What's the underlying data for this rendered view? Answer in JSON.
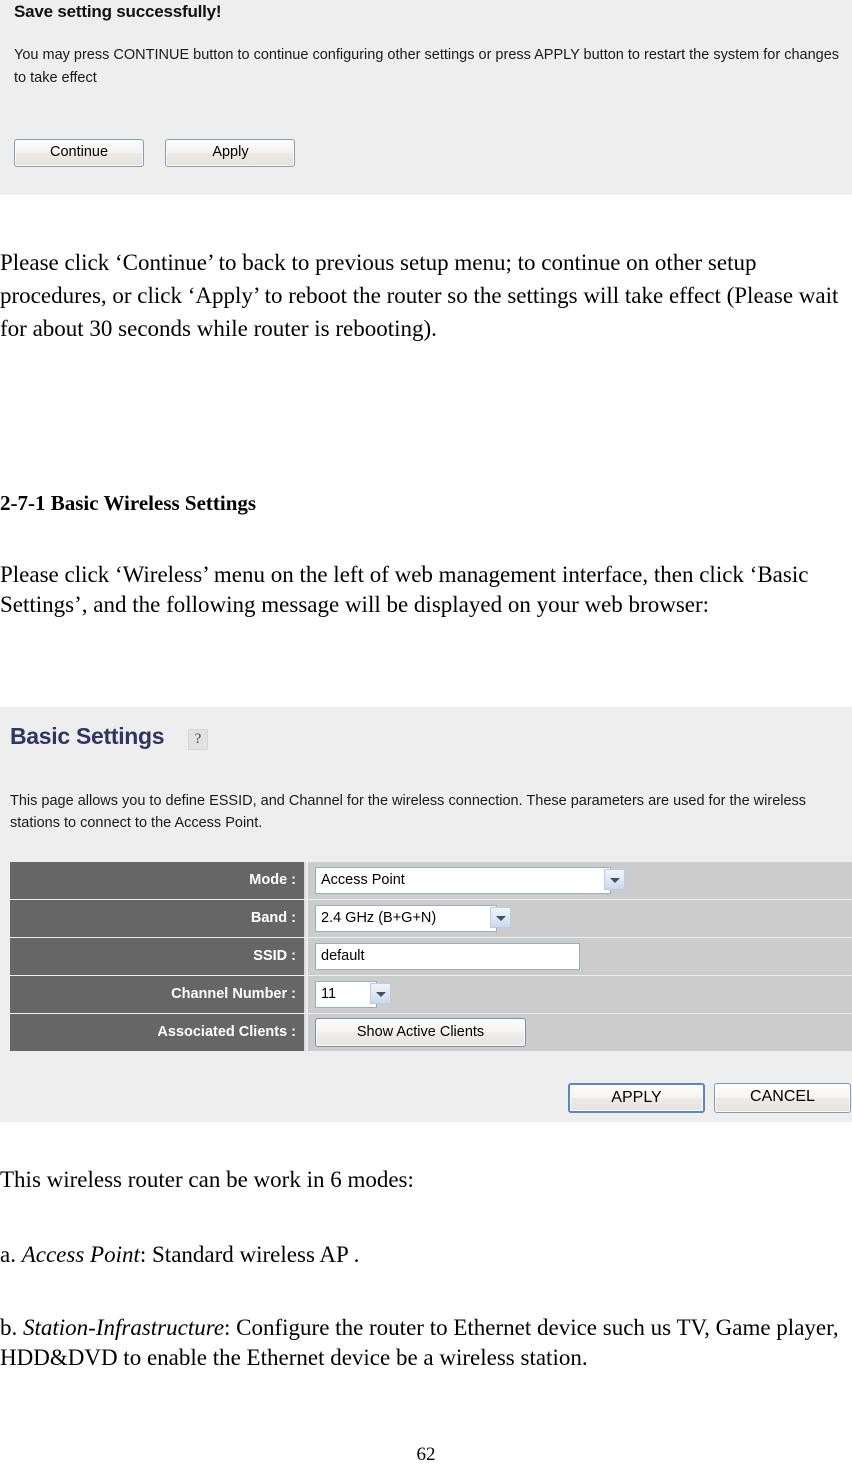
{
  "save_panel": {
    "title": "Save setting successfully!",
    "message": "You may press CONTINUE button to continue configuring other settings or press APPLY button to restart the system for changes to take effect",
    "continue_label": "Continue",
    "apply_label": "Apply"
  },
  "doc": {
    "paragraph_1": "Please click ‘Continue’ to back to previous setup menu; to continue on other setup procedures, or click ‘Apply’ to reboot the router so the settings will take effect (Please wait for about 30 seconds while router is rebooting).",
    "heading_1": "2-7-1 Basic Wireless Settings",
    "paragraph_2": "Please click ‘Wireless’ menu on the left of web management interface, then click ‘Basic Settings’, and the following message will be displayed on your web browser:",
    "paragraph_3": "This wireless router can be work in 6 modes:",
    "mode_a_prefix": "a. ",
    "mode_a_name": "Access Point",
    "mode_a_text": ": Standard wireless AP .",
    "mode_b_prefix": "b. ",
    "mode_b_name": "Station-Infrastructure",
    "mode_b_text": ": Configure the router to Ethernet device such us TV, Game player, HDD&DVD to enable the Ethernet device be a wireless station.",
    "page_number": "62"
  },
  "basic_settings": {
    "title": "Basic Settings",
    "help_icon_glyph": "?",
    "description": "This page allows you to define ESSID, and Channel for the wireless connection. These parameters are used for the wireless stations to connect to the Access Point.",
    "rows": [
      {
        "label": "Mode :",
        "value": "Access Point",
        "control": "select",
        "callout": "1"
      },
      {
        "label": "Band :",
        "value": "2.4 GHz (B+G+N)",
        "control": "select",
        "callout": "2"
      },
      {
        "label": "SSID :",
        "value": "default",
        "control": "text",
        "callout": "3"
      },
      {
        "label": "Channel Number :",
        "value": "11",
        "control": "select",
        "callout": "4"
      },
      {
        "label": "Associated Clients :",
        "value": "Show Active Clients",
        "control": "button",
        "callout": "5"
      }
    ],
    "apply_label": "APPLY",
    "cancel_label": "CANCEL"
  },
  "colors": {
    "panel_bg": "#eeeeee",
    "label_cell": "#666666",
    "field_cell": "#cccccc",
    "title_accent": "#333366",
    "focus_border": "#5a87c9"
  }
}
